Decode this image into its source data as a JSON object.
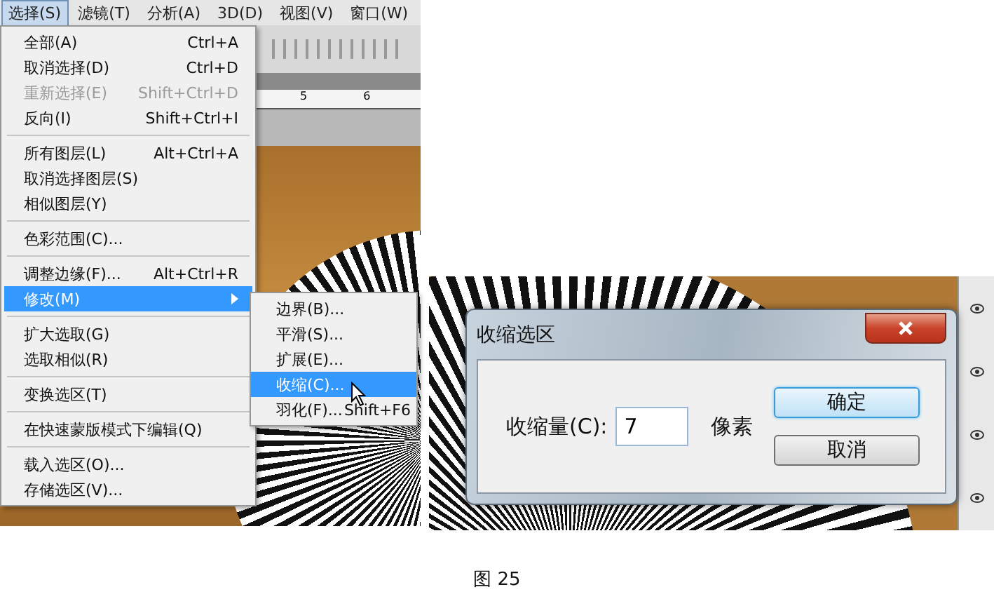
{
  "menubar": [
    {
      "label": "选择(S)",
      "selected": true
    },
    {
      "label": "滤镜(T)",
      "selected": false
    },
    {
      "label": "分析(A)",
      "selected": false
    },
    {
      "label": "3D(D)",
      "selected": false
    },
    {
      "label": "视图(V)",
      "selected": false
    },
    {
      "label": "窗口(W)",
      "selected": false
    }
  ],
  "ruler": [
    "5",
    "6"
  ],
  "menu": [
    [
      {
        "label": "全部(A)",
        "shortcut": "Ctrl+A",
        "disabled": false,
        "selected": false,
        "submenu": false
      },
      {
        "label": "取消选择(D)",
        "shortcut": "Ctrl+D",
        "disabled": false,
        "selected": false,
        "submenu": false
      },
      {
        "label": "重新选择(E)",
        "shortcut": "Shift+Ctrl+D",
        "disabled": true,
        "selected": false,
        "submenu": false
      },
      {
        "label": "反向(I)",
        "shortcut": "Shift+Ctrl+I",
        "disabled": false,
        "selected": false,
        "submenu": false
      }
    ],
    [
      {
        "label": "所有图层(L)",
        "shortcut": "Alt+Ctrl+A",
        "disabled": false,
        "selected": false,
        "submenu": false
      },
      {
        "label": "取消选择图层(S)",
        "disabled": false,
        "selected": false,
        "submenu": false
      },
      {
        "label": "相似图层(Y)",
        "disabled": false,
        "selected": false,
        "submenu": false
      }
    ],
    [
      {
        "label": "色彩范围(C)...",
        "disabled": false,
        "selected": false,
        "submenu": false
      }
    ],
    [
      {
        "label": "调整边缘(F)...",
        "shortcut": "Alt+Ctrl+R",
        "disabled": false,
        "selected": false,
        "submenu": false
      },
      {
        "label": "修改(M)",
        "disabled": false,
        "selected": true,
        "submenu": true
      }
    ],
    [
      {
        "label": "扩大选取(G)",
        "disabled": false,
        "selected": false,
        "submenu": false
      },
      {
        "label": "选取相似(R)",
        "disabled": false,
        "selected": false,
        "submenu": false
      }
    ],
    [
      {
        "label": "变换选区(T)",
        "disabled": false,
        "selected": false,
        "submenu": false
      }
    ],
    [
      {
        "label": "在快速蒙版模式下编辑(Q)",
        "disabled": false,
        "selected": false,
        "submenu": false
      }
    ],
    [
      {
        "label": "载入选区(O)...",
        "disabled": false,
        "selected": false,
        "submenu": false
      },
      {
        "label": "存储选区(V)...",
        "disabled": false,
        "selected": false,
        "submenu": false
      }
    ]
  ],
  "submenu": [
    {
      "label": "边界(B)...",
      "selected": false
    },
    {
      "label": "平滑(S)...",
      "selected": false
    },
    {
      "label": "扩展(E)...",
      "selected": false
    },
    {
      "label": "收缩(C)...",
      "selected": true
    },
    {
      "label": "羽化(F)...",
      "shortcut": "Shift+F6",
      "selected": false
    }
  ],
  "dialog": {
    "title": "收缩选区",
    "field_label": "收缩量(C):",
    "value": "7",
    "unit": "像素",
    "buttons": [
      {
        "label": "确定",
        "selected": true
      },
      {
        "label": "取消",
        "selected": false
      }
    ]
  },
  "caption": "图 25"
}
